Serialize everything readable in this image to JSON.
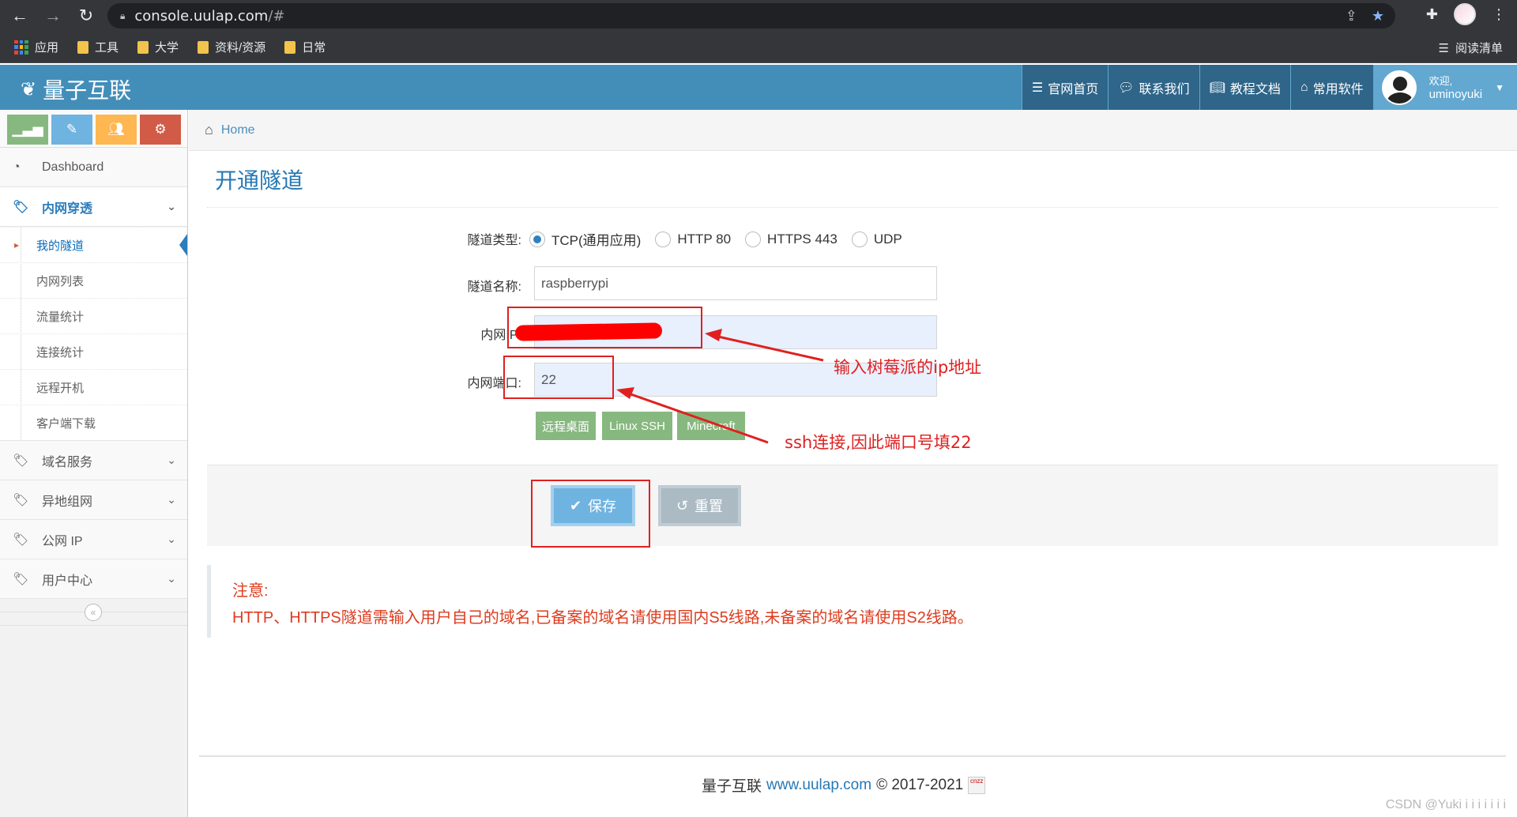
{
  "browser": {
    "url_host": "console.uulap.com",
    "url_path": "/#",
    "bookmarks": [
      "应用",
      "工具",
      "大学",
      "资料/资源",
      "日常"
    ],
    "reading_list": "阅读清单"
  },
  "header": {
    "brand": "量子互联",
    "nav": [
      "官网首页",
      "联系我们",
      "教程文档",
      "常用软件"
    ],
    "user_greeting": "欢迎,",
    "user_name": "uminoyuki"
  },
  "sidebar": {
    "shortcut_colors": [
      "#87b87f",
      "#6fb3e0",
      "#ffb752",
      "#d15b47"
    ],
    "dashboard": "Dashboard",
    "open_group": "内网穿透",
    "sub_items": [
      "我的隧道",
      "内网列表",
      "流量统计",
      "连接统计",
      "远程开机",
      "客户端下载"
    ],
    "active_sub": "我的隧道",
    "groups": [
      "域名服务",
      "异地组网",
      "公网 IP",
      "用户中心"
    ]
  },
  "breadcrumb": {
    "home": "Home"
  },
  "page": {
    "title": "开通隧道",
    "form": {
      "type_label": "隧道类型:",
      "types": [
        "TCP(通用应用)",
        "HTTP 80",
        "HTTPS 443",
        "UDP"
      ],
      "selected_type": "TCP(通用应用)",
      "name_label": "隧道名称:",
      "name_value": "raspberrypi",
      "ip_label": "内网IP:",
      "ip_value": "",
      "port_label": "内网端口:",
      "port_value": "22",
      "presets": [
        "远程桌面",
        "Linux SSH",
        "Minecraft"
      ]
    },
    "save_label": "保存",
    "reset_label": "重置",
    "notice_title": "注意:",
    "notice_text": "HTTP、HTTPS隧道需输入用户自己的域名,已备案的域名请使用国内S5线路,未备案的域名请使用S2线路。"
  },
  "footer": {
    "brand": "量子互联",
    "link": "www.uulap.com",
    "copyright": "© 2017-2021",
    "badge": "cnzz"
  },
  "annotations": {
    "ip_note": "输入树莓派的ip地址",
    "port_note": "ssh连接,因此端口号填22",
    "color": "#e02020"
  },
  "watermark": "CSDN @Yuki i i i i i i i"
}
